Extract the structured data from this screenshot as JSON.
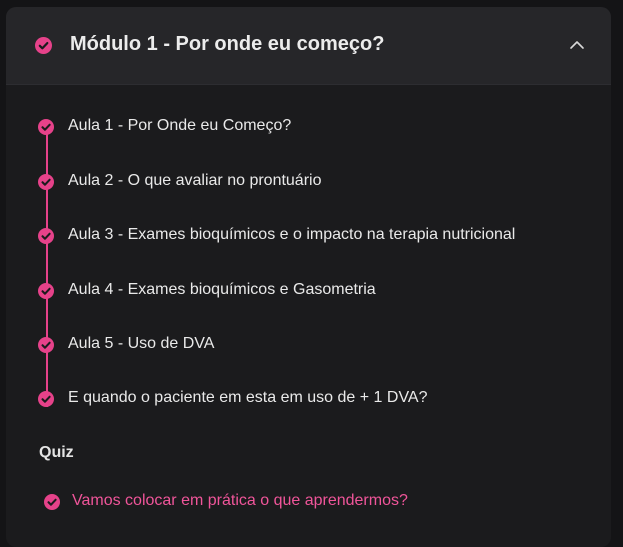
{
  "module": {
    "title": "Módulo 1 - Por onde eu começo?",
    "completed": true,
    "expanded": true
  },
  "lessons": [
    {
      "label": "Aula 1 - Por Onde eu Começo?",
      "completed": true
    },
    {
      "label": "Aula 2 - O que avaliar no prontuário",
      "completed": true
    },
    {
      "label": "Aula 3 - Exames bioquímicos e o impacto na terapia nutricional",
      "completed": true
    },
    {
      "label": "Aula 4 - Exames bioquímicos e Gasometria",
      "completed": true
    },
    {
      "label": "Aula 5 - Uso de DVA",
      "completed": true
    },
    {
      "label": "E quando o paciente em esta em uso de + 1 DVA?",
      "completed": true
    }
  ],
  "quiz": {
    "heading": "Quiz",
    "items": [
      {
        "label": "Vamos colocar em prática o que aprendermos?",
        "completed": true
      }
    ]
  },
  "colors": {
    "accent": "#e6428a",
    "background": "#1b1b1d",
    "header_background": "#262629",
    "text": "#e9e9e9"
  },
  "icons": {
    "completed": "check-circle-icon",
    "collapse": "chevron-up-icon"
  }
}
